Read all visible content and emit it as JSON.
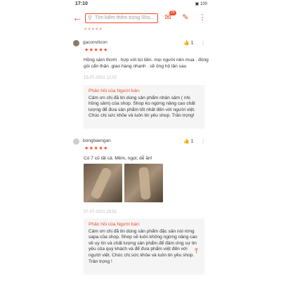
{
  "status_bar": {
    "time": "17:10",
    "icons": "▣ 100"
  },
  "search": {
    "placeholder": "Tìm kiếm thêm trong Sho..."
  },
  "header_icons": {
    "chat_badge": "20"
  },
  "reviews": [
    {
      "username": "gaconvitcon",
      "stars": "★★★★★",
      "likes": "1",
      "text": "Hồng sâm thơm . hợp với túi tiền. mọi người nên mua . đóng gói cẩn thận .giao hàng nhanh . sẽ ủng hộ lần sau",
      "date": "15-07-2021 12:02",
      "seller_title": "Phản hồi của Người bán:",
      "seller_reply": "Cảm ơn chị đã tin dùng sản phẩm nhân sâm ( nhị hồng sâm) của shop. Shop ko ngừng nâng cao chất lượng để đưa sản phẩm tốt nhất đến với người việt. Chúc chị sức khỏe và luôn tin yêu shop. Trân trọng!"
    },
    {
      "username": "bongbaengan",
      "stars": "★★★★★",
      "likes": "1",
      "text": "Có 7 củ tất cả. Mềm, ngọt, dễ ăn!",
      "date": "07-07-2021 15:51",
      "seller_title": "Phản hồi của Người bán:",
      "seller_reply": "Cảm ơn chị đã tin dùng sản phẩm đặc sản núi rừng sapa của shop. Shop sẽ luôn không ngừng nâng cao về uy tín và chất lượng sản phẩm để đảm ứng sự tin yêu của quý khách và để đưa phẩm việt đến với người việt. Chúc chị sức khỏe và luôn tin yêu shop. Trân trọng !"
    }
  ],
  "colors": {
    "accent": "#ee4d2d"
  }
}
